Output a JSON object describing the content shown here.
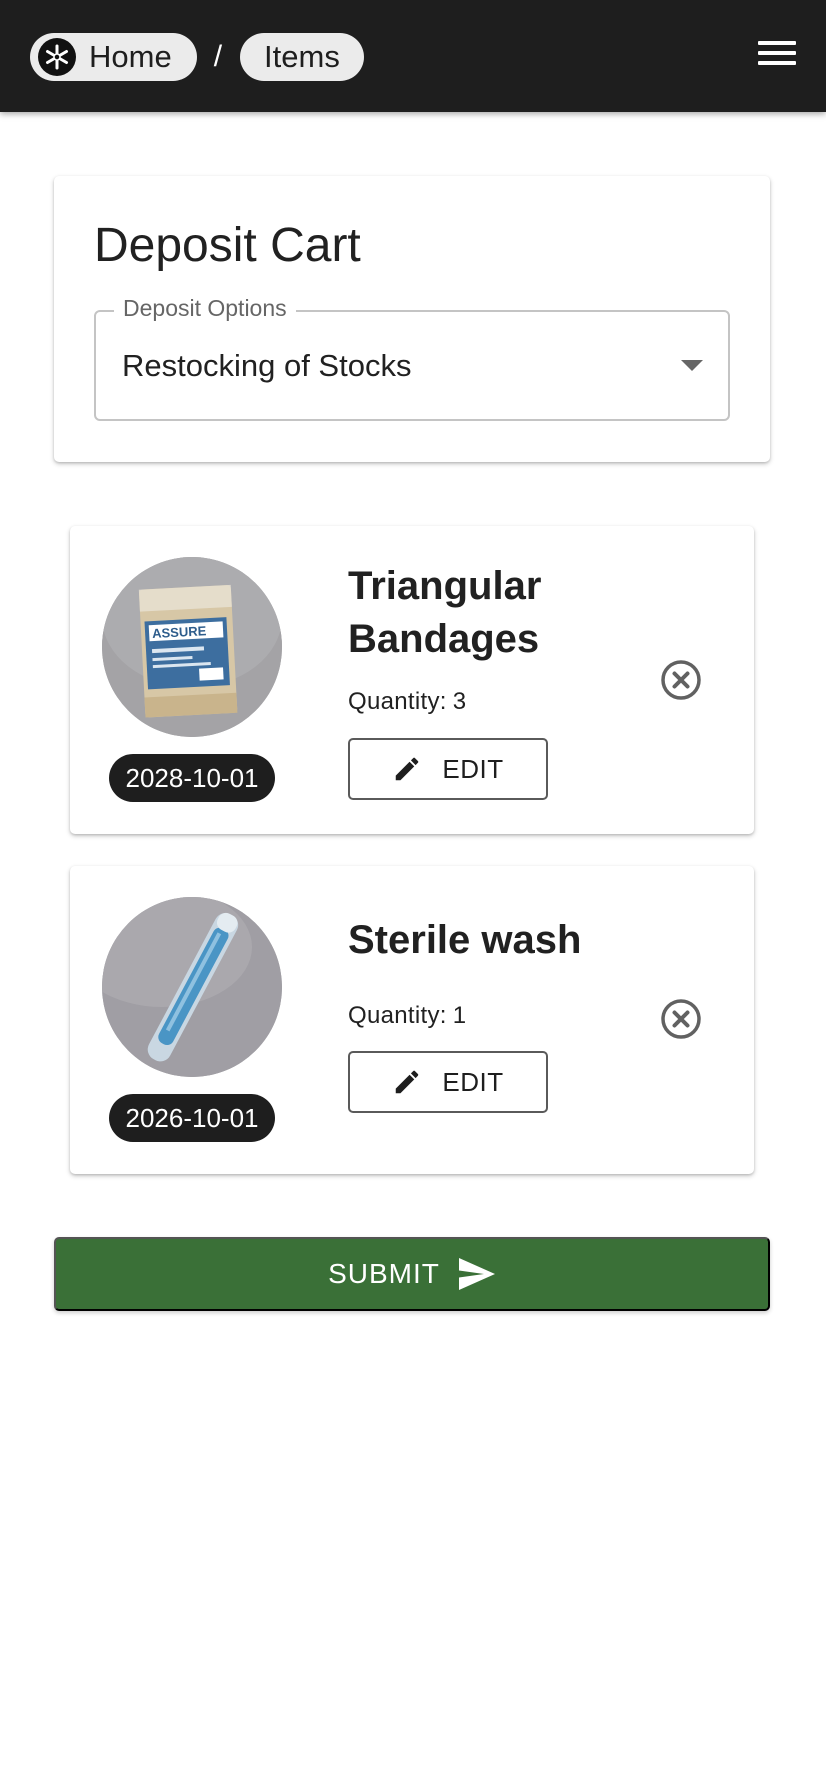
{
  "header": {
    "breadcrumbs": [
      {
        "label": "Home"
      },
      {
        "label": "Items"
      }
    ],
    "separator": "/",
    "menu_icon": "hamburger-menu-icon",
    "logo_icon": "star-of-life-logo-icon"
  },
  "cart": {
    "title": "Deposit Cart",
    "deposit_options": {
      "label": "Deposit Options",
      "value": "Restocking of Stocks"
    }
  },
  "items": [
    {
      "name": "Triangular Bandages",
      "quantity_label": "Quantity:",
      "quantity": "3",
      "expiry_date": "2028-10-01",
      "edit_label": "EDIT",
      "image_icon": "bandage-package-photo"
    },
    {
      "name": "Sterile wash",
      "quantity_label": "Quantity:",
      "quantity": "1",
      "expiry_date": "2026-10-01",
      "edit_label": "EDIT",
      "image_icon": "sterile-wash-vial-photo"
    }
  ],
  "submit": {
    "label": "SUBMIT",
    "icon": "send-icon"
  },
  "colors": {
    "appbar": "#1e1e1e",
    "submit": "#3a7037",
    "badge": "#1e1e1e"
  }
}
